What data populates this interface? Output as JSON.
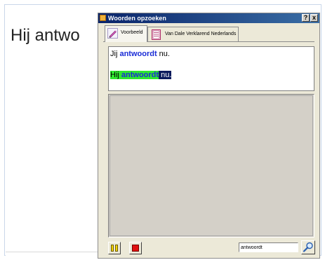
{
  "document": {
    "visible_text": "Hij antwo"
  },
  "dialog": {
    "title": "Woorden opzoeken",
    "help_label": "?",
    "close_label": "x",
    "tabs": [
      {
        "label": "Voorbeeld",
        "icon": "pen-icon",
        "active": true
      },
      {
        "label": "Van Dale Verklarend Nederlands",
        "icon": "dictionary-icon",
        "active": false
      }
    ],
    "example": {
      "line1": {
        "pre": "Jij ",
        "word": "antwoordt",
        "post": " nu."
      },
      "line2": {
        "pre": "Hij ",
        "word": "antwoordt",
        "post": " nu."
      }
    },
    "search": {
      "value": "antwoordt",
      "button_icon": "search-magnifier-icon"
    },
    "controls": {
      "pause_icon": "pause-icon",
      "stop_icon": "stop-icon"
    }
  },
  "colors": {
    "titlebar_start": "#0a246a",
    "titlebar_end": "#3a6ea5",
    "highlight_word": "#1a2cd6",
    "highlight_green": "#2ee82e",
    "highlight_navy": "#0a1a5c",
    "dialog_bg": "#ece9d8"
  }
}
